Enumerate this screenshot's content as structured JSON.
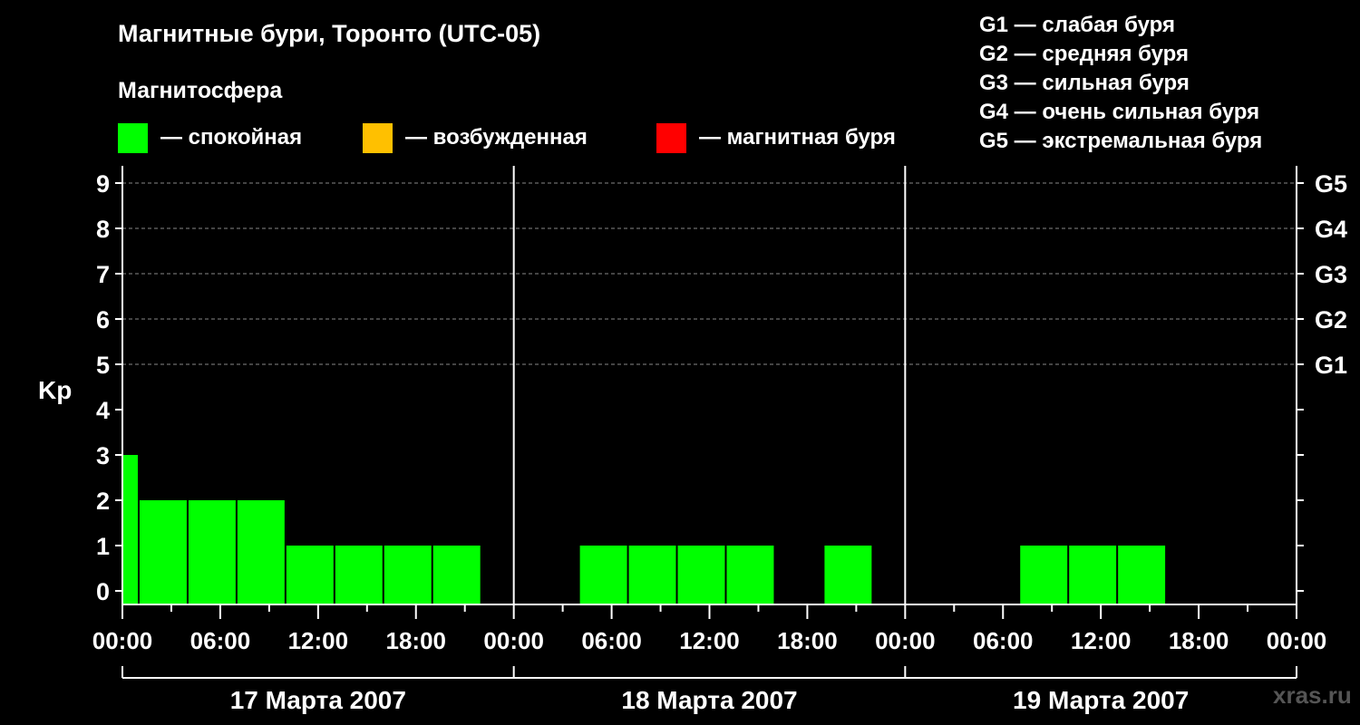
{
  "title": "Магнитные бури, Торонто (UTC-05)",
  "subtitle": "Магнитосфера",
  "legend": [
    {
      "label": "— спокойная",
      "color": "#00ff00"
    },
    {
      "label": "— возбужденная",
      "color": "#ffc000"
    },
    {
      "label": "— магнитная буря",
      "color": "#ff0000"
    }
  ],
  "g_scale": [
    "G1 — слабая буря",
    "G2 — средняя буря",
    "G3 — сильная буря",
    "G4 — очень сильная буря",
    "G5 — экстремальная буря"
  ],
  "watermark": "xras.ru",
  "chart_data": {
    "type": "bar",
    "ylabel": "Kp",
    "ylim": [
      0,
      9
    ],
    "yticks": [
      0,
      1,
      2,
      3,
      4,
      5,
      6,
      7,
      8,
      9
    ],
    "right_ticks": [
      {
        "value": 5,
        "label": "G1"
      },
      {
        "value": 6,
        "label": "G2"
      },
      {
        "value": 7,
        "label": "G3"
      },
      {
        "value": 8,
        "label": "G4"
      },
      {
        "value": 9,
        "label": "G5"
      }
    ],
    "grid": "dashed horizontal lines at 5-9",
    "xlim_hours": [
      0,
      72
    ],
    "xtick_labels": [
      "00:00",
      "06:00",
      "12:00",
      "18:00",
      "00:00",
      "06:00",
      "12:00",
      "18:00",
      "00:00",
      "06:00",
      "12:00",
      "18:00",
      "00:00"
    ],
    "days": [
      "17 Марта 2007",
      "18 Марта 2007",
      "19 Марта 2007"
    ],
    "series": [
      {
        "values": [
          {
            "start": 0,
            "end": 1,
            "kp": 3,
            "level": "спокойная"
          },
          {
            "start": 1,
            "end": 4,
            "kp": 2,
            "level": "спокойная"
          },
          {
            "start": 4,
            "end": 7,
            "kp": 2,
            "level": "спокойная"
          },
          {
            "start": 7,
            "end": 10,
            "kp": 2,
            "level": "спокойная"
          },
          {
            "start": 10,
            "end": 13,
            "kp": 1,
            "level": "спокойная"
          },
          {
            "start": 13,
            "end": 16,
            "kp": 1,
            "level": "спокойная"
          },
          {
            "start": 16,
            "end": 19,
            "kp": 1,
            "level": "спокойная"
          },
          {
            "start": 19,
            "end": 22,
            "kp": 1,
            "level": "спокойная"
          },
          {
            "start": 22,
            "end": 25,
            "kp": 0,
            "level": "спокойная"
          },
          {
            "start": 25,
            "end": 28,
            "kp": 0,
            "level": "спокойная"
          },
          {
            "start": 28,
            "end": 31,
            "kp": 1,
            "level": "спокойная"
          },
          {
            "start": 31,
            "end": 34,
            "kp": 1,
            "level": "спокойная"
          },
          {
            "start": 34,
            "end": 37,
            "kp": 1,
            "level": "спокойная"
          },
          {
            "start": 37,
            "end": 40,
            "kp": 1,
            "level": "спокойная"
          },
          {
            "start": 40,
            "end": 43,
            "kp": 0,
            "level": "спокойная"
          },
          {
            "start": 43,
            "end": 46,
            "kp": 1,
            "level": "спокойная"
          },
          {
            "start": 46,
            "end": 49,
            "kp": 0,
            "level": "спокойная"
          },
          {
            "start": 49,
            "end": 52,
            "kp": 0,
            "level": "спокойная"
          },
          {
            "start": 52,
            "end": 55,
            "kp": 0,
            "level": "спокойная"
          },
          {
            "start": 55,
            "end": 58,
            "kp": 1,
            "level": "спокойная"
          },
          {
            "start": 58,
            "end": 61,
            "kp": 1,
            "level": "спокойная"
          },
          {
            "start": 61,
            "end": 64,
            "kp": 1,
            "level": "спокойная"
          }
        ]
      }
    ]
  }
}
